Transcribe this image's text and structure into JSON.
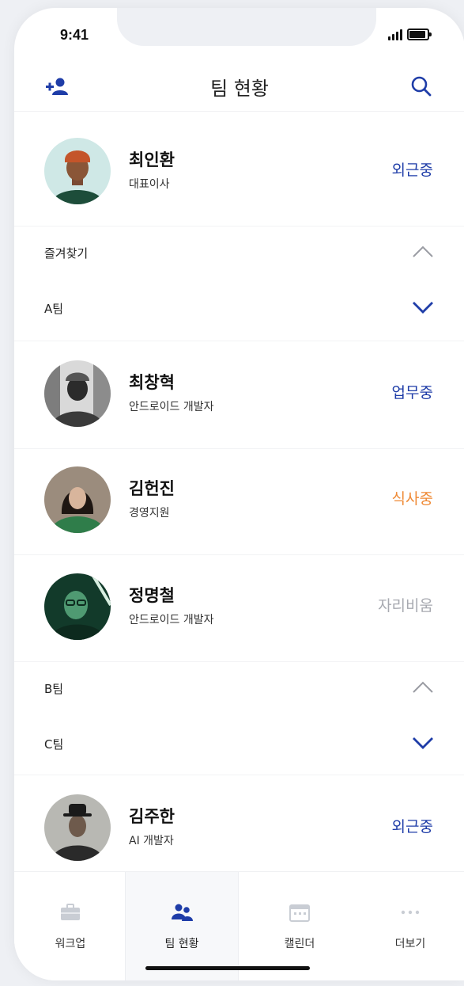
{
  "status_bar": {
    "time": "9:41"
  },
  "header": {
    "title": "팀 현황",
    "add_icon": "add-user-icon",
    "search_icon": "search-icon"
  },
  "me": {
    "name": "최인환",
    "role": "대표이사",
    "status": "외근중"
  },
  "groups": [
    {
      "label": "즐겨찾기",
      "state": "collapsed"
    },
    {
      "label": "A팀",
      "state": "expanded"
    },
    {
      "label": "B팀",
      "state": "collapsed"
    },
    {
      "label": "C팀",
      "state": "expanded"
    }
  ],
  "members": [
    {
      "name": "최창혁",
      "role": "안드로이드 개발자",
      "status": "업무중"
    },
    {
      "name": "김헌진",
      "role": "경영지원",
      "status": "식사중"
    },
    {
      "name": "정명철",
      "role": "안드로이드 개발자",
      "status": "자리비움"
    },
    {
      "name": "김주한",
      "role": "AI 개발자",
      "status": "외근중"
    }
  ],
  "colors": {
    "accent": "#1f3da8",
    "meal": "#ef8a36",
    "away": "#a7a9b0"
  },
  "tabs": [
    {
      "label": "워크업",
      "icon": "briefcase-icon"
    },
    {
      "label": "팀 현황",
      "icon": "team-icon",
      "active": true
    },
    {
      "label": "캘린더",
      "icon": "calendar-icon"
    },
    {
      "label": "더보기",
      "icon": "more-icon"
    }
  ]
}
